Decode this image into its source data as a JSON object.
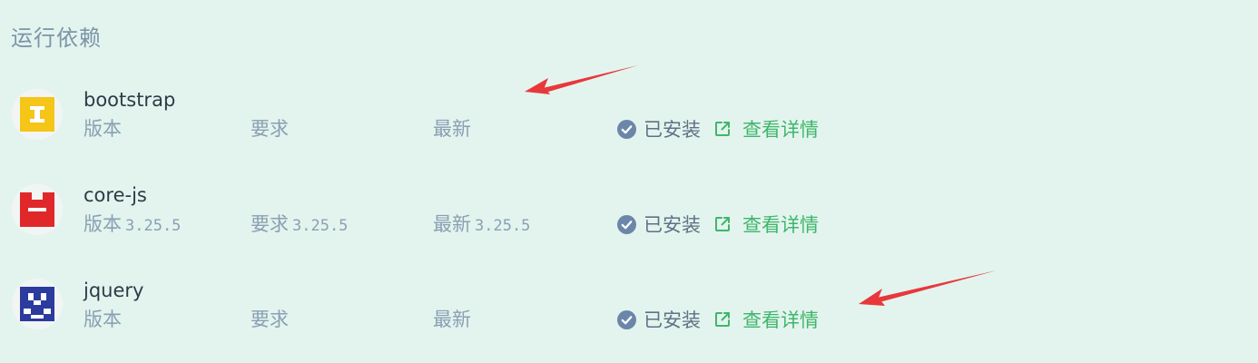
{
  "section": {
    "title": "运行依赖"
  },
  "dependencies": [
    {
      "name": "bootstrap",
      "version_label": "版本",
      "version": "",
      "required_label": "要求",
      "required": "",
      "latest_label": "最新",
      "latest": "",
      "status": "已安装",
      "details_label": "查看详情",
      "avatar_color": "#f5c518",
      "avatar_icon": "bootstrap-identicon"
    },
    {
      "name": "core-js",
      "version_label": "版本",
      "version": "3.25.5",
      "required_label": "要求",
      "required": "3.25.5",
      "latest_label": "最新",
      "latest": "3.25.5",
      "status": "已安装",
      "details_label": "查看详情",
      "avatar_color": "#e0282b",
      "avatar_icon": "core-js-identicon"
    },
    {
      "name": "jquery",
      "version_label": "版本",
      "version": "",
      "required_label": "要求",
      "required": "",
      "latest_label": "最新",
      "latest": "",
      "status": "已安装",
      "details_label": "查看详情",
      "avatar_color": "#2b3b9e",
      "avatar_icon": "jquery-identicon"
    }
  ],
  "colors": {
    "background": "#e3f4ee",
    "status_check": "#6b86a8",
    "details_link": "#3fb66a",
    "annotation_arrow": "#e8383b"
  }
}
